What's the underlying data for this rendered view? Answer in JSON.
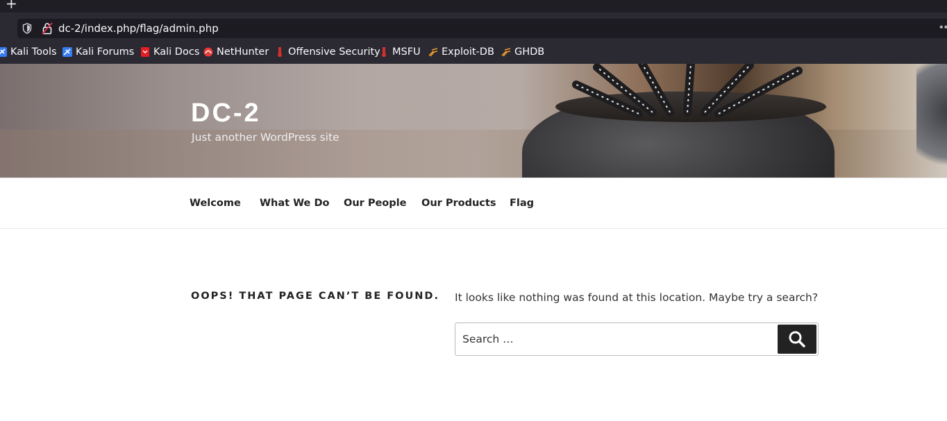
{
  "browser": {
    "new_tab_glyph": "+",
    "url": "dc-2/index.php/flag/admin.php",
    "more_glyph": "•••",
    "bookmarks": [
      {
        "label": "Kali Tools",
        "icon": "kali-dragon-icon",
        "color": "#367bf0"
      },
      {
        "label": "Kali Forums",
        "icon": "kali-dragon-icon",
        "color": "#367bf0"
      },
      {
        "label": "Kali Docs",
        "icon": "kali-docs-icon",
        "color": "#e51c23"
      },
      {
        "label": "NetHunter",
        "icon": "nethunter-icon",
        "color": "#e53935"
      },
      {
        "label": "Offensive Security",
        "icon": "offsec-icon",
        "color": "#d32f2f"
      },
      {
        "label": "MSFU",
        "icon": "offsec-icon",
        "color": "#d32f2f"
      },
      {
        "label": "Exploit-DB",
        "icon": "exploitdb-bug-icon",
        "color": "#f09a2a"
      },
      {
        "label": "GHDB",
        "icon": "exploitdb-bug-icon",
        "color": "#f09a2a"
      }
    ]
  },
  "site": {
    "title": "DC-2",
    "description": "Just another WordPress site"
  },
  "nav": {
    "items": [
      "Welcome",
      "What We Do",
      "Our People",
      "Our Products",
      "Flag"
    ]
  },
  "content": {
    "error_title": "OOPS! THAT PAGE CAN’T BE FOUND.",
    "message": "It looks like nothing was found at this location. Maybe try a search?",
    "search_placeholder": "Search …"
  }
}
